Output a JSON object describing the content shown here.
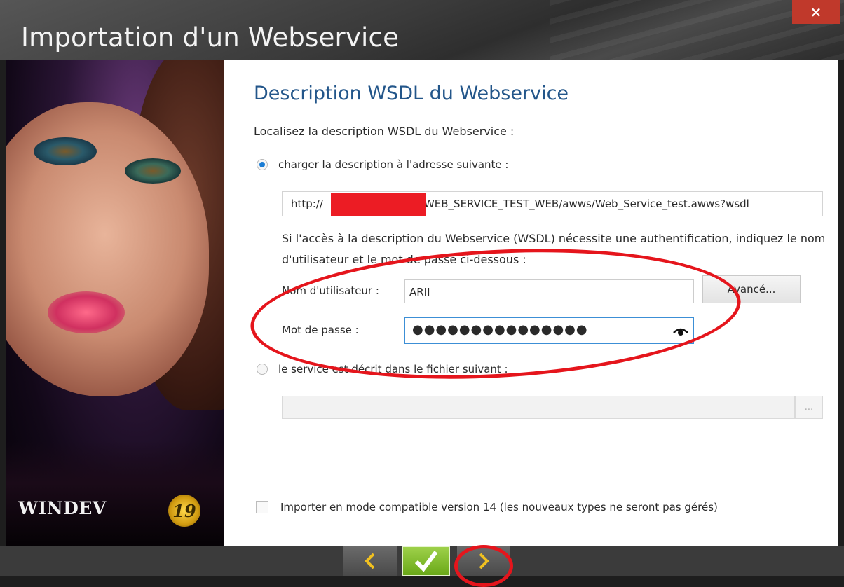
{
  "window": {
    "title": "Importation d'un Webservice",
    "close_label": "×"
  },
  "sidebar": {
    "logo_text": "WINDEV",
    "logo_badge": "19"
  },
  "main": {
    "heading": "Description WSDL du Webservice",
    "intro": "Localisez la description WSDL du Webservice :",
    "option_url_label": "charger la description à l'adresse suivante :",
    "url_start": "http://",
    "url_end": "WEB_SERVICE_TEST_WEB/awws/Web_Service_test.awws?wsdl",
    "auth_text": "Si l'accès à la description du Webservice (WSDL) nécessite une authentification, indiquez le nom d'utilisateur et le mot de passe ci-dessous :",
    "username_label": "Nom d'utilisateur :",
    "username_value": "ARII",
    "password_label": "Mot de passe :",
    "password_value": "●●●●●●●●●●●●●●●",
    "advanced_label": "Avancé...",
    "option_file_label": "le service est décrit dans le fichier suivant :",
    "browse_label": "...",
    "compat_label": "Importer en mode compatible version 14 (les nouveaux types ne seront pas gérés)"
  },
  "footer": {
    "back_icon": "chevron-left-icon",
    "ok_icon": "checkmark-icon",
    "next_icon": "chevron-right-icon"
  },
  "colors": {
    "accent": "#1a7cd4",
    "heading": "#23568a",
    "annotation": "#e5151c",
    "ok_green": "#7ab82a"
  }
}
